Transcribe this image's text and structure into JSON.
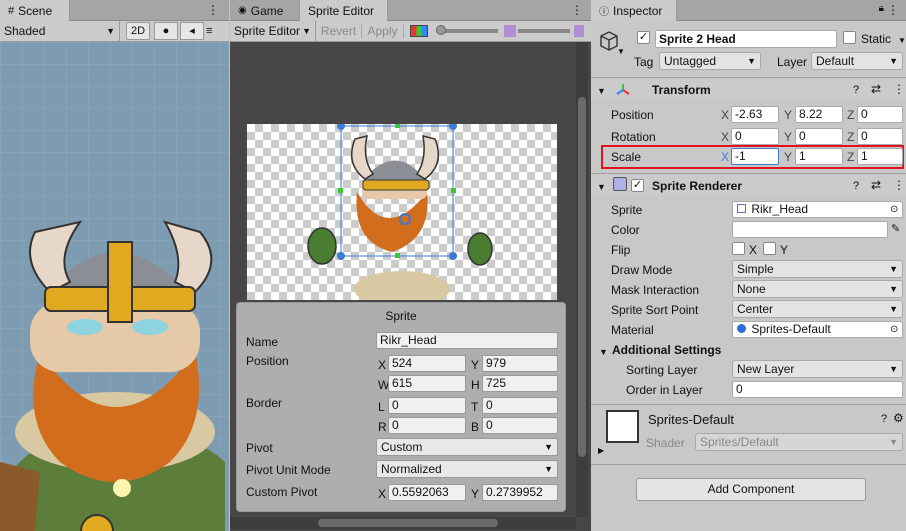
{
  "scene": {
    "tab": "Scene",
    "shading": "Shaded",
    "mode_2d": "2D"
  },
  "game": {
    "tab": "Game"
  },
  "sprite_editor": {
    "tab": "Sprite Editor",
    "menu": "Sprite Editor",
    "revert": "Revert",
    "apply": "Apply",
    "panel": {
      "title": "Sprite",
      "name_label": "Name",
      "name_value": "Rikr_Head",
      "position_label": "Position",
      "pos_x_label": "X",
      "pos_x": "524",
      "pos_y_label": "Y",
      "pos_y": "979",
      "pos_w_label": "W",
      "pos_w": "615",
      "pos_h_label": "H",
      "pos_h": "725",
      "border_label": "Border",
      "border_l_label": "L",
      "border_l": "0",
      "border_t_label": "T",
      "border_t": "0",
      "border_r_label": "R",
      "border_r": "0",
      "border_b_label": "B",
      "border_b": "0",
      "pivot_label": "Pivot",
      "pivot_value": "Custom",
      "pivot_unit_label": "Pivot Unit Mode",
      "pivot_unit_value": "Normalized",
      "custom_pivot_label": "Custom Pivot",
      "cp_x_label": "X",
      "cp_x": "0.5592063",
      "cp_y_label": "Y",
      "cp_y": "0.2739952"
    }
  },
  "inspector": {
    "tab": "Inspector",
    "object_name": "Sprite 2 Head",
    "static_label": "Static",
    "tag_label": "Tag",
    "tag_value": "Untagged",
    "layer_label": "Layer",
    "layer_value": "Default",
    "transform": {
      "title": "Transform",
      "position_label": "Position",
      "pos": {
        "x": "-2.63",
        "y": "8.22",
        "z": "0"
      },
      "rotation_label": "Rotation",
      "rot": {
        "x": "0",
        "y": "0",
        "z": "0"
      },
      "scale_label": "Scale",
      "scale": {
        "x": "-1",
        "y": "1",
        "z": "1"
      },
      "x_label": "X",
      "y_label": "Y",
      "z_label": "Z"
    },
    "sprite_renderer": {
      "title": "Sprite Renderer",
      "sprite_label": "Sprite",
      "sprite_value": "Rikr_Head",
      "color_label": "Color",
      "flip_label": "Flip",
      "flip_x": "X",
      "flip_y": "Y",
      "draw_mode_label": "Draw Mode",
      "draw_mode_value": "Simple",
      "mask_label": "Mask Interaction",
      "mask_value": "None",
      "sort_point_label": "Sprite Sort Point",
      "sort_point_value": "Center",
      "material_label": "Material",
      "material_value": "Sprites-Default",
      "additional_label": "Additional Settings",
      "sorting_layer_label": "Sorting Layer",
      "sorting_layer_value": "New Layer",
      "order_label": "Order in Layer",
      "order_value": "0"
    },
    "material": {
      "name": "Sprites-Default",
      "shader_label": "Shader",
      "shader_value": "Sprites/Default"
    },
    "add_component": "Add Component"
  },
  "colors": {
    "highlight": "#e0141e",
    "selection": "#3b7bd6"
  }
}
